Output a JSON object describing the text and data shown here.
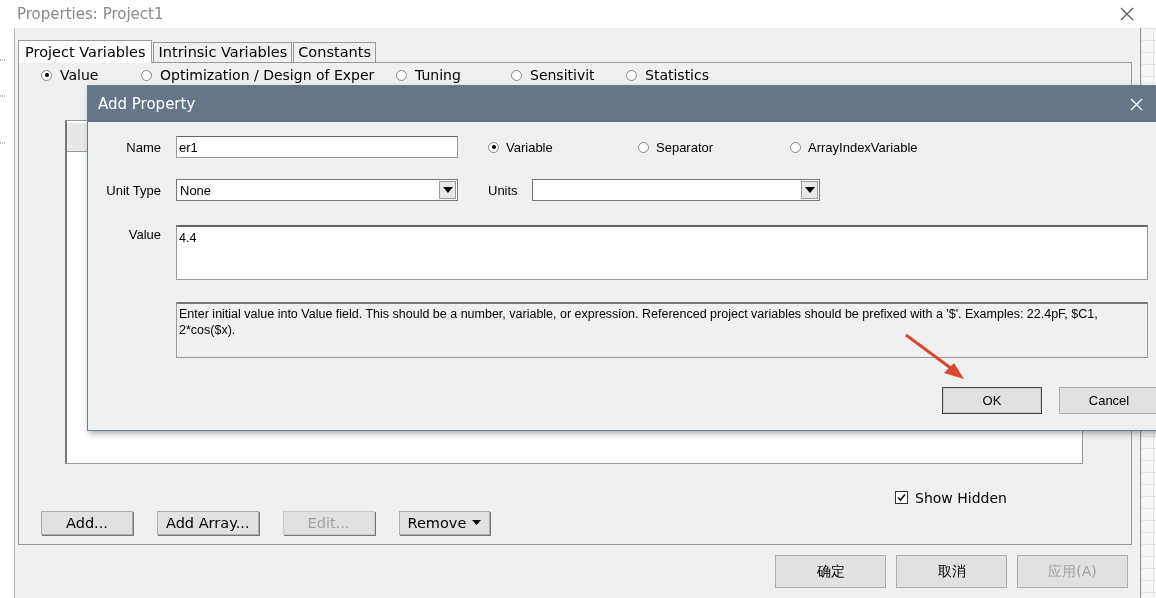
{
  "window": {
    "title": "Properties: Project1"
  },
  "tabs": [
    {
      "label": "Project Variables",
      "selected": true
    },
    {
      "label": "Intrinsic Variables",
      "selected": false
    },
    {
      "label": "Constants",
      "selected": false
    }
  ],
  "mode_options": [
    {
      "label": "Value",
      "selected": true
    },
    {
      "label": "Optimization / Design of Exper",
      "selected": false
    },
    {
      "label": "Tuning",
      "selected": false
    },
    {
      "label": "Sensitivit",
      "selected": false
    },
    {
      "label": "Statistics",
      "selected": false
    }
  ],
  "show_hidden": {
    "label": "Show Hidden",
    "checked": true
  },
  "actions": [
    {
      "label": "Add...",
      "kind": "button",
      "disabled": false
    },
    {
      "label": "Add Array...",
      "kind": "button",
      "disabled": false
    },
    {
      "label": "Edit...",
      "kind": "button",
      "disabled": true
    },
    {
      "label": "Remove",
      "kind": "menu",
      "disabled": false
    }
  ],
  "footer_buttons": [
    {
      "label": "确定",
      "disabled": false
    },
    {
      "label": "取消",
      "disabled": false
    },
    {
      "label": "应用(A)",
      "disabled": true
    }
  ],
  "dialog": {
    "title": "Add Property",
    "name_label": "Name",
    "name_value": "er1",
    "types": [
      {
        "label": "Variable",
        "selected": true
      },
      {
        "label": "Separator",
        "selected": false
      },
      {
        "label": "ArrayIndexVariable",
        "selected": false
      }
    ],
    "unit_type_label": "Unit Type",
    "unit_type_value": "None",
    "units_label": "Units",
    "value_label": "Value",
    "value": "4.4",
    "help": "Enter initial value into Value field. This should be a number, variable, or expression. Referenced project variables should be prefixed with a '$'. Examples: 22.4pF, $C1, 2*cos($x).",
    "buttons": [
      {
        "label": "OK",
        "default": true
      },
      {
        "label": "Cancel",
        "default": false
      }
    ]
  }
}
